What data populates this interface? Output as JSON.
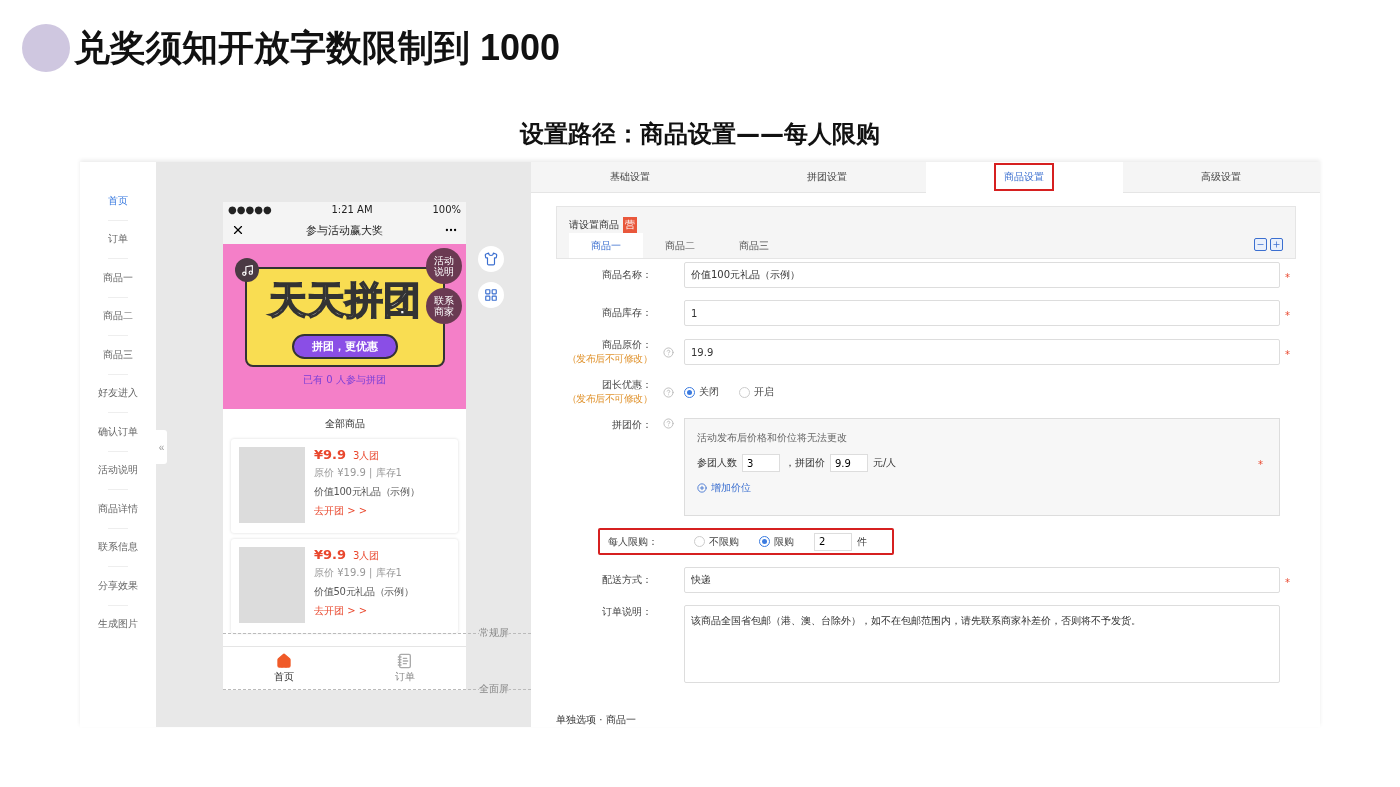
{
  "slide": {
    "title": "兑奖须知开放字数限制到 1000",
    "subtitle": "设置路径：商品设置——每人限购"
  },
  "sidebar": {
    "collapse": "«",
    "items": [
      {
        "label": "首页",
        "selected": true
      },
      {
        "label": "订单",
        "selected": false
      },
      {
        "label": "商品一",
        "selected": false
      },
      {
        "label": "商品二",
        "selected": false
      },
      {
        "label": "商品三",
        "selected": false
      },
      {
        "label": "好友进入",
        "selected": false
      },
      {
        "label": "确认订单",
        "selected": false
      },
      {
        "label": "活动说明",
        "selected": false
      },
      {
        "label": "商品详情",
        "selected": false
      },
      {
        "label": "联系信息",
        "selected": false
      },
      {
        "label": "分享效果",
        "selected": false
      },
      {
        "label": "生成图片",
        "selected": false
      }
    ]
  },
  "phone": {
    "status": {
      "signal": "●●●●●",
      "time": "1:21 AM",
      "battery": "100%"
    },
    "nav_title": "参与活动赢大奖",
    "banner": {
      "title": "天天拼团",
      "slogan": "拼团，更优惠",
      "participants": "已有 0 人参与拼团",
      "badges": [
        "活动说明",
        "联系商家"
      ]
    },
    "section_title": "全部商品",
    "products": [
      {
        "price": "¥9.9",
        "group": "3人团",
        "meta": "原价 ¥19.9 | 库存1",
        "name": "价值100元礼品（示例）",
        "action": "去开团 > >"
      },
      {
        "price": "¥9.9",
        "group": "3人团",
        "meta": "原价 ¥19.9 | 库存1",
        "name": "价值50元礼品（示例）",
        "action": "去开团 > >"
      }
    ],
    "tabbar": [
      {
        "label": "首页",
        "selected": true
      },
      {
        "label": "订单",
        "selected": false
      }
    ],
    "screen_marks": [
      "常规屏",
      "全面屏"
    ]
  },
  "form": {
    "tabs": [
      {
        "label": "基础设置",
        "selected": false,
        "highlighted": false
      },
      {
        "label": "拼团设置",
        "selected": false,
        "highlighted": false
      },
      {
        "label": "商品设置",
        "selected": true,
        "highlighted": true
      },
      {
        "label": "高级设置",
        "selected": false,
        "highlighted": false
      }
    ],
    "product_panel": {
      "title": "请设置商品",
      "badge": "营",
      "tabs": [
        {
          "label": "商品一",
          "selected": true
        },
        {
          "label": "商品二",
          "selected": false
        },
        {
          "label": "商品三",
          "selected": false
        }
      ]
    },
    "fields": [
      {
        "kind": "input",
        "label": "商品名称：",
        "help": false,
        "value": "价值100元礼品（示例）",
        "mark": "*"
      },
      {
        "kind": "input",
        "label": "商品库存：",
        "help": false,
        "value": "1",
        "mark": "*"
      },
      {
        "kind": "input",
        "label": "商品原价：",
        "note": "（发布后不可修改）",
        "help": true,
        "value": "19.9",
        "mark": "*"
      },
      {
        "kind": "radio",
        "label": "团长优惠：",
        "note": "（发布后不可修改）",
        "help": true,
        "options": [
          {
            "label": "关闭",
            "selected": true
          },
          {
            "label": "开启",
            "selected": false
          }
        ]
      },
      {
        "kind": "tiers",
        "label": "拼团价：",
        "help": true,
        "hint": "活动发布后价格和价位将无法更改",
        "size_label": "参团人数",
        "size": "3",
        "price_label": "，拼团价",
        "price": "9.9",
        "unit": "元/人",
        "add": "增加价位",
        "mark": "*"
      },
      {
        "kind": "limit",
        "label": "每人限购：",
        "highlighted": true,
        "options": [
          {
            "label": "不限购",
            "selected": false
          },
          {
            "label": "限购",
            "selected": true
          }
        ],
        "value": "2",
        "unit": "件"
      },
      {
        "kind": "input",
        "label": "配送方式：",
        "help": false,
        "value": "快递",
        "mark": "*"
      },
      {
        "kind": "textarea",
        "label": "订单说明：",
        "help": false,
        "value": "该商品全国省包邮（港、澳、台除外），如不在包邮范围内，请先联系商家补差价，否则将不予发货。"
      }
    ],
    "footer_label": "单独选项 · 商品一"
  }
}
